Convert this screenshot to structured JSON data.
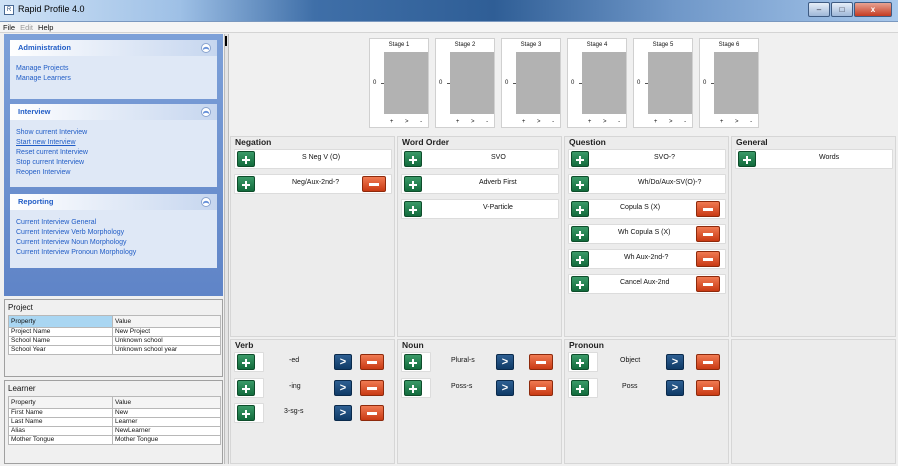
{
  "window": {
    "title": "Rapid Profile 4.0",
    "min": "–",
    "max": "□",
    "close": "x"
  },
  "menu": {
    "file": "File",
    "edit": "Edit",
    "help": "Help"
  },
  "administration": {
    "title": "Administration",
    "items": [
      "Manage Projects",
      "Manage Learners"
    ]
  },
  "interview": {
    "title": "Interview",
    "items": [
      "Show current Interview",
      "Start new Interview",
      "Reset current Interview",
      "Stop current Interview",
      "Reopen Interview"
    ]
  },
  "reporting": {
    "title": "Reporting",
    "items": [
      "Current Interview General",
      "Current Interview Verb Morphology",
      "Current Interview Noun Morphology",
      "Current Interview Pronoun Morphology"
    ]
  },
  "project": {
    "title": "Project",
    "header": [
      "Property",
      "Value"
    ],
    "rows": [
      [
        "Project Name",
        "New Project"
      ],
      [
        "School Name",
        "Unknown school"
      ],
      [
        "School Year",
        "Unknown school year"
      ]
    ]
  },
  "learner": {
    "title": "Learner",
    "header": [
      "Property",
      "Value"
    ],
    "rows": [
      [
        "First Name",
        "New"
      ],
      [
        "Last Name",
        "Learner"
      ],
      [
        "Alias",
        "NewLearner"
      ],
      [
        "Mother Tongue",
        "Mother Tongue"
      ]
    ]
  },
  "stages": [
    {
      "title": "Stage 1",
      "zero": "0",
      "axis": [
        "+",
        ">",
        "-"
      ]
    },
    {
      "title": "Stage 2",
      "zero": "0",
      "axis": [
        "+",
        ">",
        "-"
      ]
    },
    {
      "title": "Stage 3",
      "zero": "0",
      "axis": [
        "+",
        ">",
        "-"
      ]
    },
    {
      "title": "Stage 4",
      "zero": "0",
      "axis": [
        "+",
        ">",
        "-"
      ]
    },
    {
      "title": "Stage 5",
      "zero": "0",
      "axis": [
        "+",
        ">",
        "-"
      ]
    },
    {
      "title": "Stage 6",
      "zero": "0",
      "axis": [
        "+",
        ">",
        "-"
      ]
    }
  ],
  "negation": {
    "title": "Negation",
    "items": [
      "S Neg V (O)",
      "Neg/Aux-2nd-?"
    ]
  },
  "word_order": {
    "title": "Word Order",
    "items": [
      "SVO",
      "Adverb First",
      "V-Particle"
    ]
  },
  "question": {
    "title": "Question",
    "items": [
      "SVO-?",
      "Wh/Do/Aux-SV(O)-?",
      "Copula S (X)",
      "Wh Copula S (X)",
      "Wh Aux-2nd-?",
      "Cancel Aux-2nd"
    ]
  },
  "general": {
    "title": "General",
    "items": [
      "Words"
    ]
  },
  "verb": {
    "title": "Verb",
    "items": [
      "-ed",
      "-ing",
      "3-sg-s"
    ]
  },
  "noun": {
    "title": "Noun",
    "items": [
      "Plural-s",
      "Poss-s"
    ]
  },
  "pronoun": {
    "title": "Pronoun",
    "items": [
      "Object",
      "Poss"
    ]
  },
  "colors": {
    "link": "#215dc6",
    "plus": "#126b3c",
    "minus": "#c93a14",
    "next": "#0f3a66"
  }
}
